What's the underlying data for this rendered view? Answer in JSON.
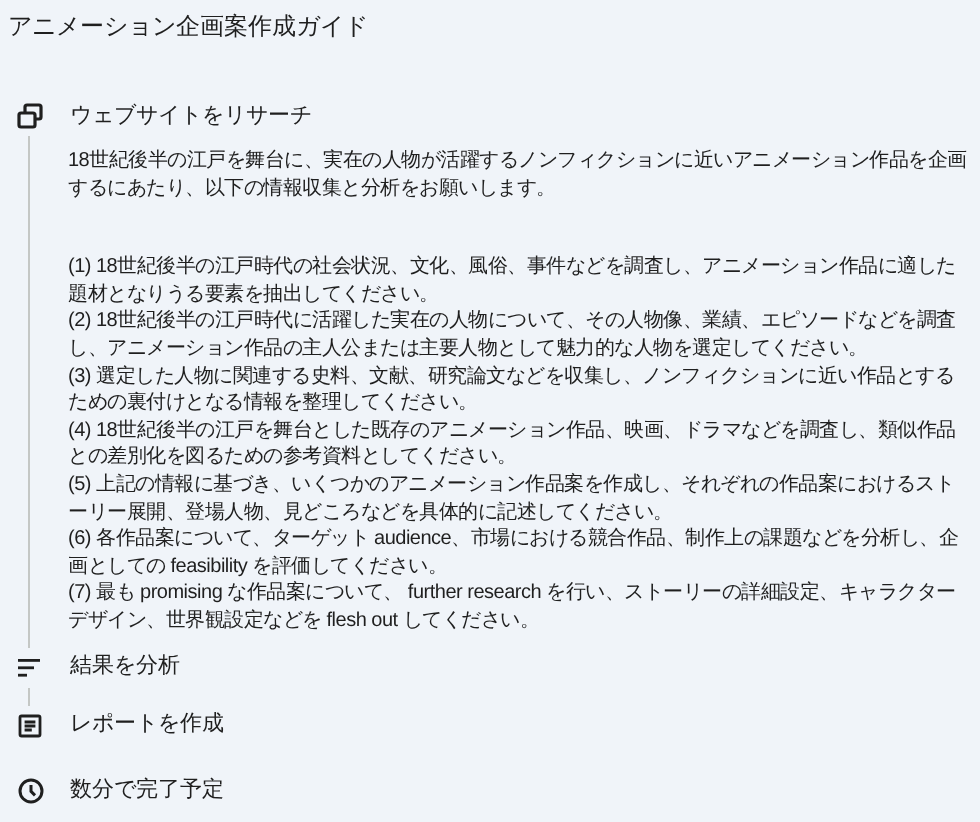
{
  "title": "アニメーション企画案作成ガイド",
  "steps": [
    {
      "kind": "research",
      "label": "ウェブサイトをリサーチ",
      "intro": "18世紀後半の江戸を舞台に、実在の人物が活躍するノンフィクションに近いアニメーション作品を企画するにあたり、以下の情報収集と分析をお願いします。",
      "items": [
        "(1) 18世紀後半の江戸時代の社会状況、文化、風俗、事件などを調査し、アニメーション作品に適した題材となりうる要素を抽出してください。",
        "(2) 18世紀後半の江戸時代に活躍した実在の人物について、その人物像、業績、エピソードなどを調査し、アニメーション作品の主人公または主要人物として魅力的な人物を選定してください。",
        "(3) 選定した人物に関連する史料、文献、研究論文などを収集し、ノンフィクションに近い作品とするための裏付けとなる情報を整理してください。",
        "(4) 18世紀後半の江戸を舞台とした既存のアニメーション作品、映画、ドラマなどを調査し、類似作品との差別化を図るための参考資料としてください。",
        "(5) 上記の情報に基づき、いくつかのアニメーション作品案を作成し、それぞれの作品案におけるストーリー展開、登場人物、見どころなどを具体的に記述してください。",
        "(6) 各作品案について、ターゲット audience、市場における競合作品、制作上の課題などを分析し、企画としての feasibility を評価してください。",
        "(7) 最も promising な作品案について、 further research を行い、ストーリーの詳細設定、キャラクターデザイン、世界観設定などを flesh out してください。"
      ]
    },
    {
      "kind": "analyze",
      "label": "結果を分析"
    },
    {
      "kind": "report",
      "label": "レポートを作成"
    }
  ],
  "eta": {
    "label": "数分で完了予定"
  }
}
